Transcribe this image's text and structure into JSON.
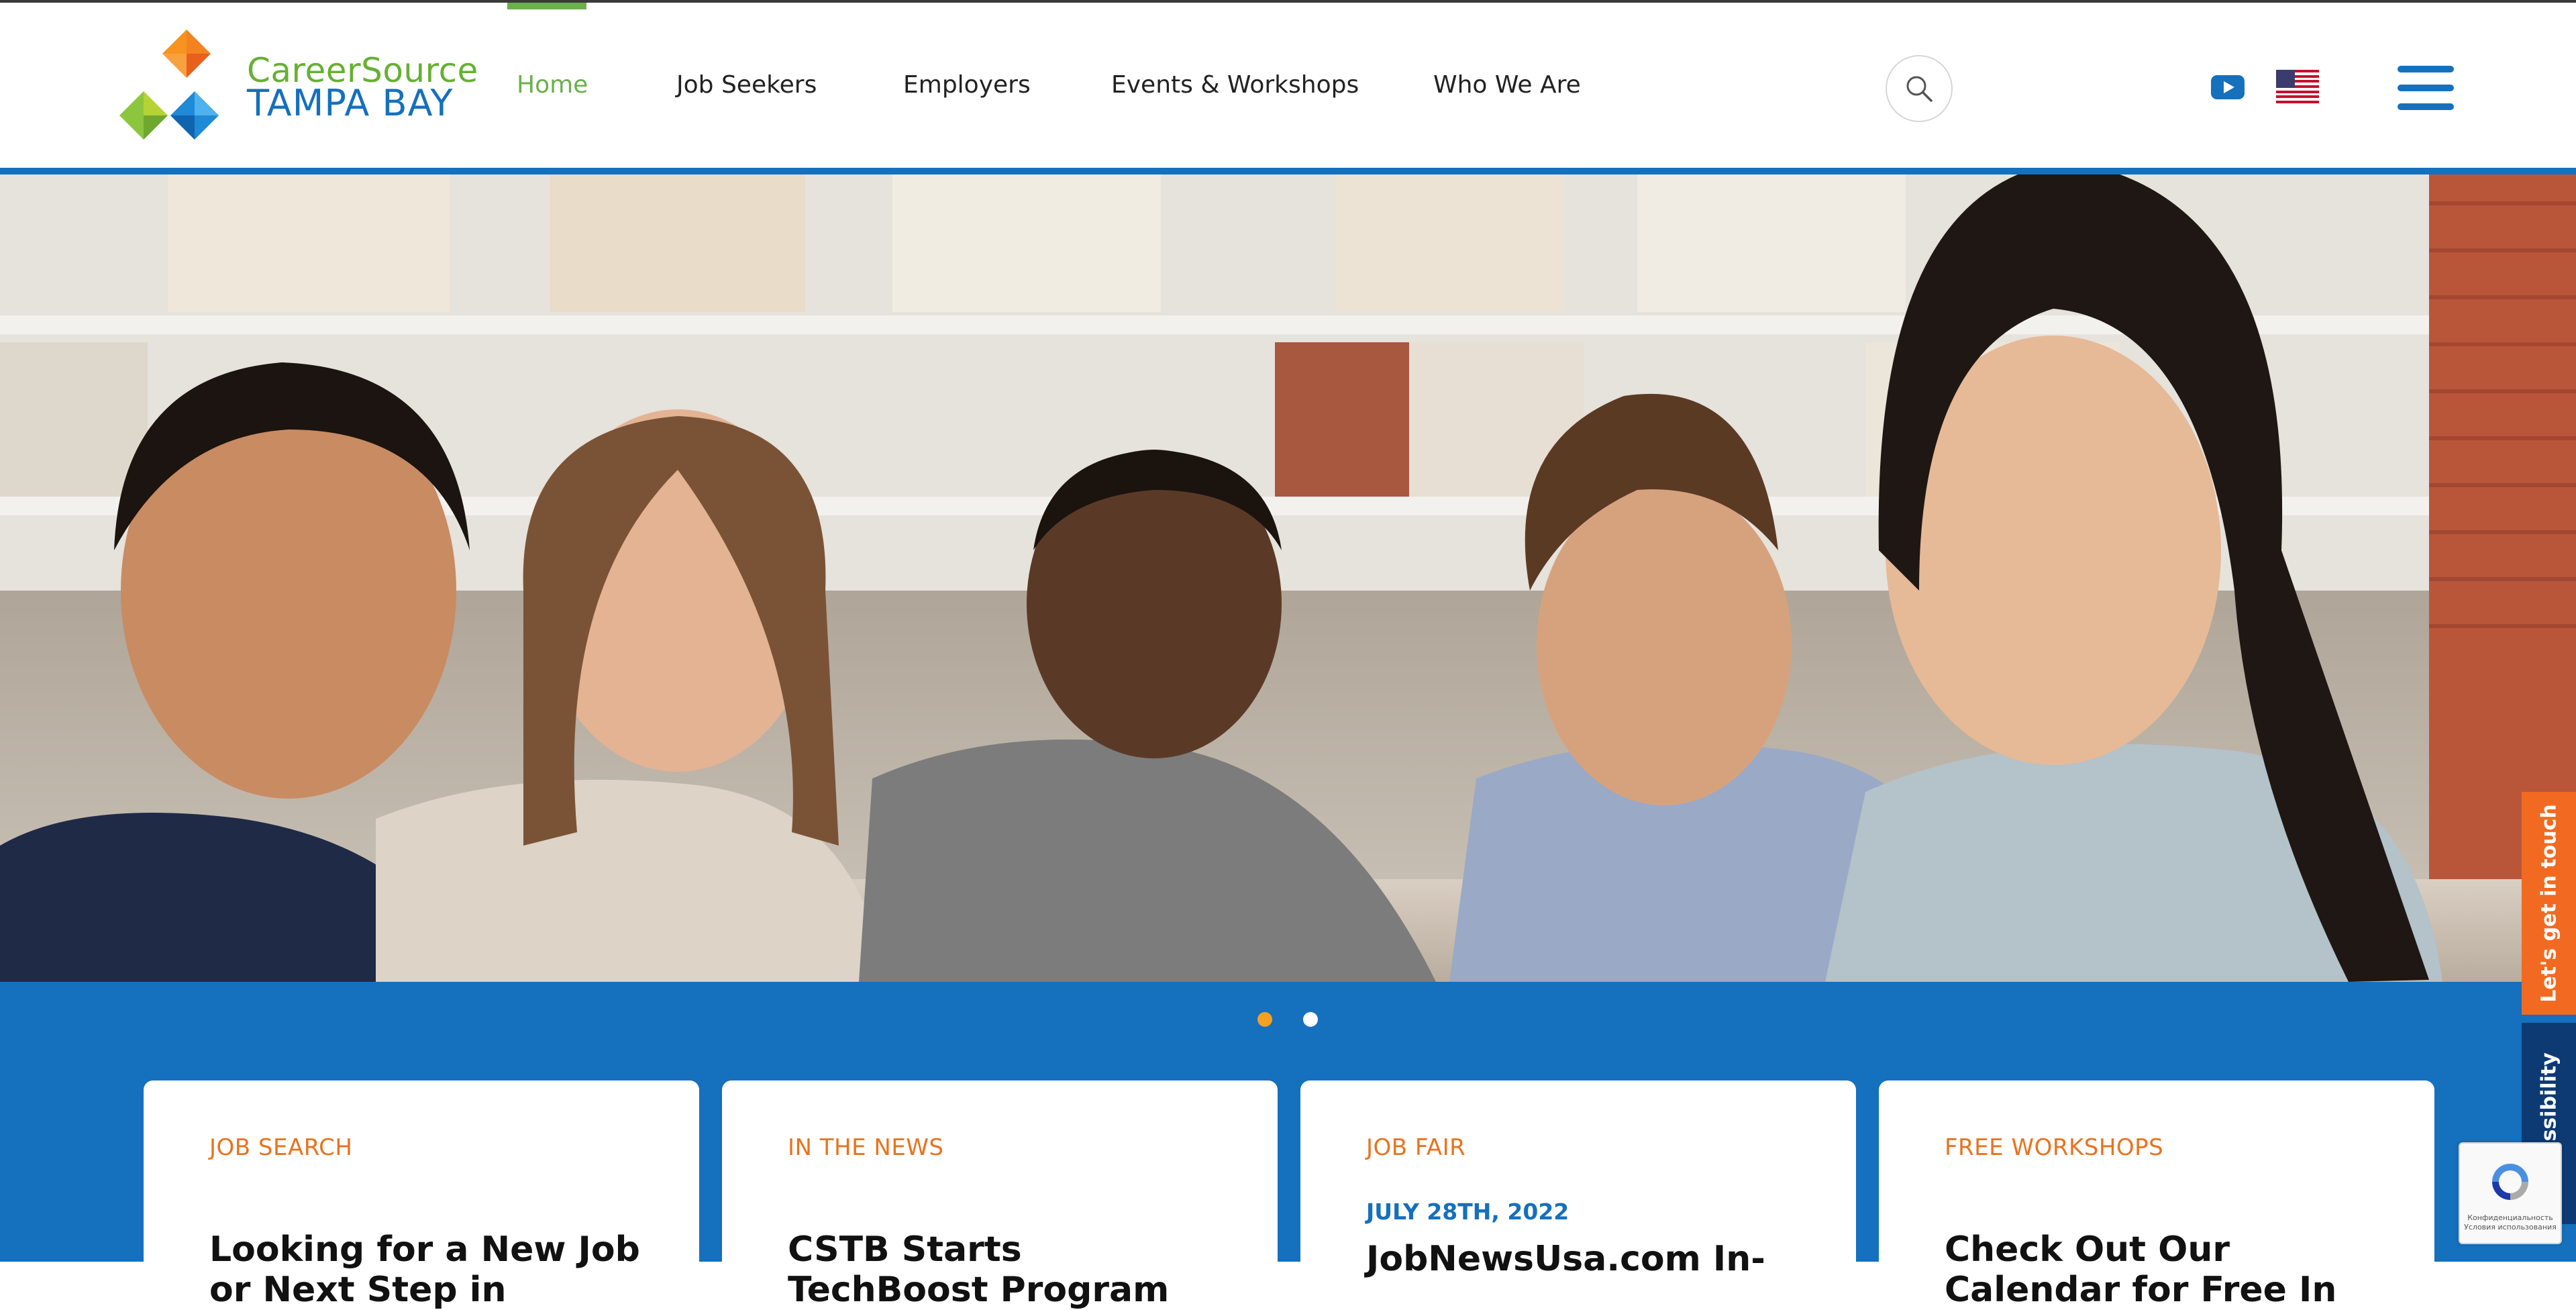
{
  "brand": {
    "line1": "CareerSource",
    "line2": "TAMPA BAY",
    "colors": {
      "blue": "#1570bd",
      "green": "#66b032",
      "orange": "#e8731f",
      "navy": "#0d3a73"
    }
  },
  "nav": {
    "items": [
      {
        "label": "Home",
        "active": true
      },
      {
        "label": "Job Seekers",
        "active": false
      },
      {
        "label": "Employers",
        "active": false
      },
      {
        "label": "Events & Workshops",
        "active": false
      },
      {
        "label": "Who We Are",
        "active": false
      }
    ]
  },
  "header_icons": [
    "search-icon",
    "youtube-icon",
    "us-flag-icon",
    "hamburger-menu-icon"
  ],
  "hero": {
    "image": "photo of five smiling young adults at a table in front of bookshelves",
    "slides_total": 2,
    "active_slide": 1
  },
  "cards": [
    {
      "category": "JOB SEARCH",
      "date": "",
      "title": "Looking for a New Job or Next Step in"
    },
    {
      "category": "IN THE NEWS",
      "date": "",
      "title": "CSTB Starts TechBoost Program"
    },
    {
      "category": "JOB FAIR",
      "date": "JULY 28TH, 2022",
      "title": "JobNewsUsa.com In-"
    },
    {
      "category": "FREE WORKSHOPS",
      "date": "",
      "title": "Check Out Our Calendar for Free In"
    }
  ],
  "side_tabs": {
    "contact": "Let's get in touch",
    "accessibility": "Accessibility"
  },
  "recaptcha": {
    "line1": "Конфиденциальность",
    "line2": "Условия использования"
  }
}
